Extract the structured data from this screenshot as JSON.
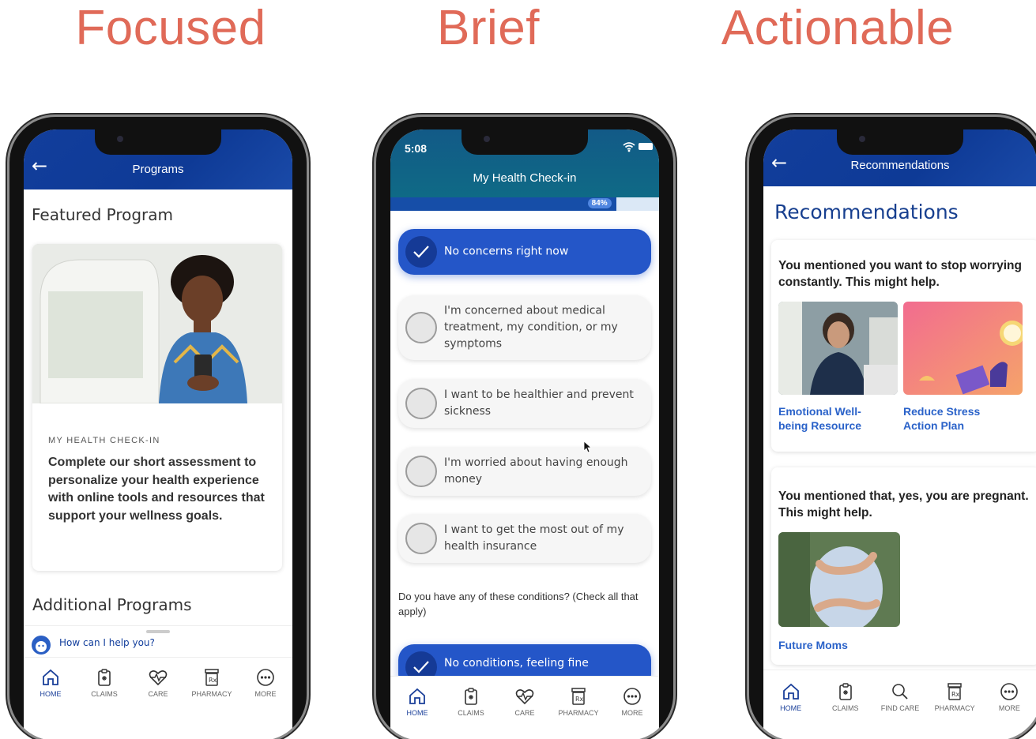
{
  "headings": [
    "Focused",
    "Brief",
    "Actionable"
  ],
  "tabbar_default": [
    {
      "label": "HOME",
      "icon": "home-icon"
    },
    {
      "label": "CLAIMS",
      "icon": "clipboard-icon"
    },
    {
      "label": "CARE",
      "icon": "heartbeat-icon"
    },
    {
      "label": "PHARMACY",
      "icon": "pharmacy-icon"
    },
    {
      "label": "MORE",
      "icon": "more-icon"
    }
  ],
  "phone1": {
    "title": "Programs",
    "featured_title": "Featured Program",
    "card_eyebrow": "MY HEALTH CHECK-IN",
    "card_body": "Complete our short assessment to personalize your health experience with online tools and resources that support your wellness goals.",
    "additional_title": "Additional Programs",
    "assistant_prompt": "How can I help you?"
  },
  "phone2": {
    "time": "5:08",
    "title": "My Health Check-in",
    "progress": 0.84,
    "progress_label": "84%",
    "options": [
      {
        "text": "No concerns right now",
        "selected": true
      },
      {
        "text": "I'm concerned about medical treatment, my condition, or my symptoms",
        "selected": false
      },
      {
        "text": "I want to be healthier and prevent sickness",
        "selected": false
      },
      {
        "text": "I'm worried about having enough money",
        "selected": false
      },
      {
        "text": "I want to get the most out of my health insurance",
        "selected": false
      }
    ],
    "question2": "Do you have any of these conditions? (Check all that apply)",
    "option2_selected": "No conditions, feeling fine"
  },
  "phone3": {
    "title": "Recommendations",
    "page_title": "Recommendations",
    "card1_head": "You mentioned you want to stop worrying constantly. This might help.",
    "card1_links": [
      "Emotional Well-being Resource",
      "Reduce Stress Action Plan"
    ],
    "card2_head": "You mentioned that, yes, you are pregnant. This might help.",
    "card2_link": "Future Moms",
    "tabs": [
      {
        "label": "HOME",
        "icon": "home-icon"
      },
      {
        "label": "CLAIMS",
        "icon": "clipboard-icon"
      },
      {
        "label": "FIND CARE",
        "icon": "search-icon"
      },
      {
        "label": "PHARMACY",
        "icon": "pharmacy-icon"
      },
      {
        "label": "MORE",
        "icon": "more-icon"
      }
    ]
  },
  "colors": {
    "heading": "#e06a58",
    "brand": "#123e9c",
    "link": "#2a62c9",
    "selected": "#2456c8"
  }
}
